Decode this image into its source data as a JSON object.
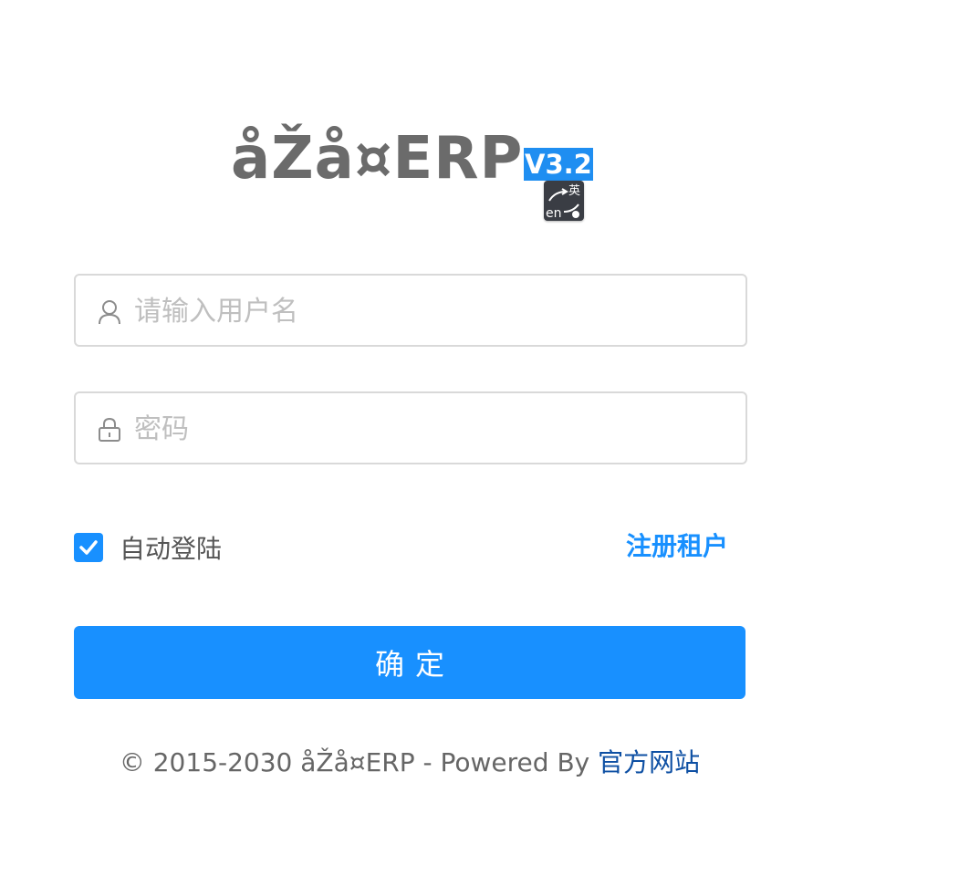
{
  "header": {
    "app_title": "åŽå¤ERP",
    "version": "V3.2",
    "translate_badge": {
      "icon": "translate-en-icon",
      "top_glyph": "英",
      "bottom_text": "en"
    }
  },
  "login_form": {
    "username": {
      "icon": "user-icon",
      "placeholder": "请输入用户名",
      "value": ""
    },
    "password": {
      "icon": "lock-icon",
      "placeholder": "密码",
      "value": ""
    },
    "remember": {
      "label": "自动登陆",
      "checked": true
    },
    "register_link": "注册租户",
    "submit_label": "确定"
  },
  "footer": {
    "copyright": "© 2015-2030 åŽå¤ERP - Powered By",
    "official_site_link": "官方网站"
  },
  "colors": {
    "primary": "#1890ff",
    "title_gray": "#6b6b6b",
    "link_dark_blue": "#0d4fa3",
    "version_highlight": "#1f8ef1"
  }
}
